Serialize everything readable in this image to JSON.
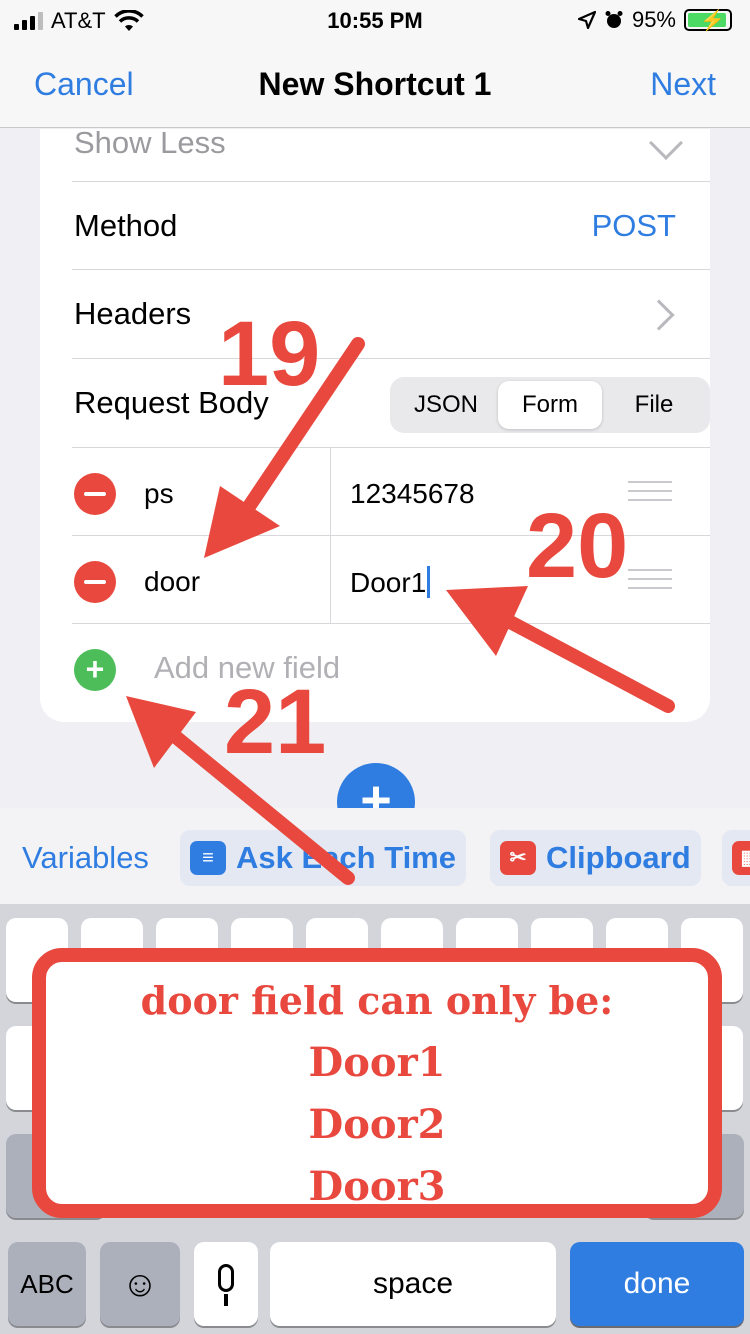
{
  "status_bar": {
    "carrier": "AT&T",
    "time": "10:55 PM",
    "battery": "95%"
  },
  "nav": {
    "cancel": "Cancel",
    "title": "New Shortcut 1",
    "next": "Next"
  },
  "card": {
    "show_less": "Show Less",
    "method_label": "Method",
    "method_value": "POST",
    "headers_label": "Headers",
    "request_body_label": "Request Body",
    "segments": [
      "JSON",
      "Form",
      "File"
    ],
    "selected_segment": "Form",
    "fields": [
      {
        "key": "ps",
        "value": "12345678"
      },
      {
        "key": "door",
        "value": "Door1"
      }
    ],
    "add_field_placeholder": "Add new field"
  },
  "variables_bar": {
    "label": "Variables",
    "chips": [
      "Ask Each Time",
      "Clipboard"
    ]
  },
  "keyboard": {
    "abc": "ABC",
    "space": "space",
    "done": "done"
  },
  "annotations": {
    "numbers": [
      "19",
      "20",
      "21"
    ],
    "note_lines": [
      "door field can only be:",
      "Door1",
      "Door2",
      "Door3"
    ],
    "color": "#e8483d"
  },
  "colors": {
    "accent": "#2f7de1",
    "delete_red": "#e8483d",
    "add_green": "#4dbd5a"
  }
}
